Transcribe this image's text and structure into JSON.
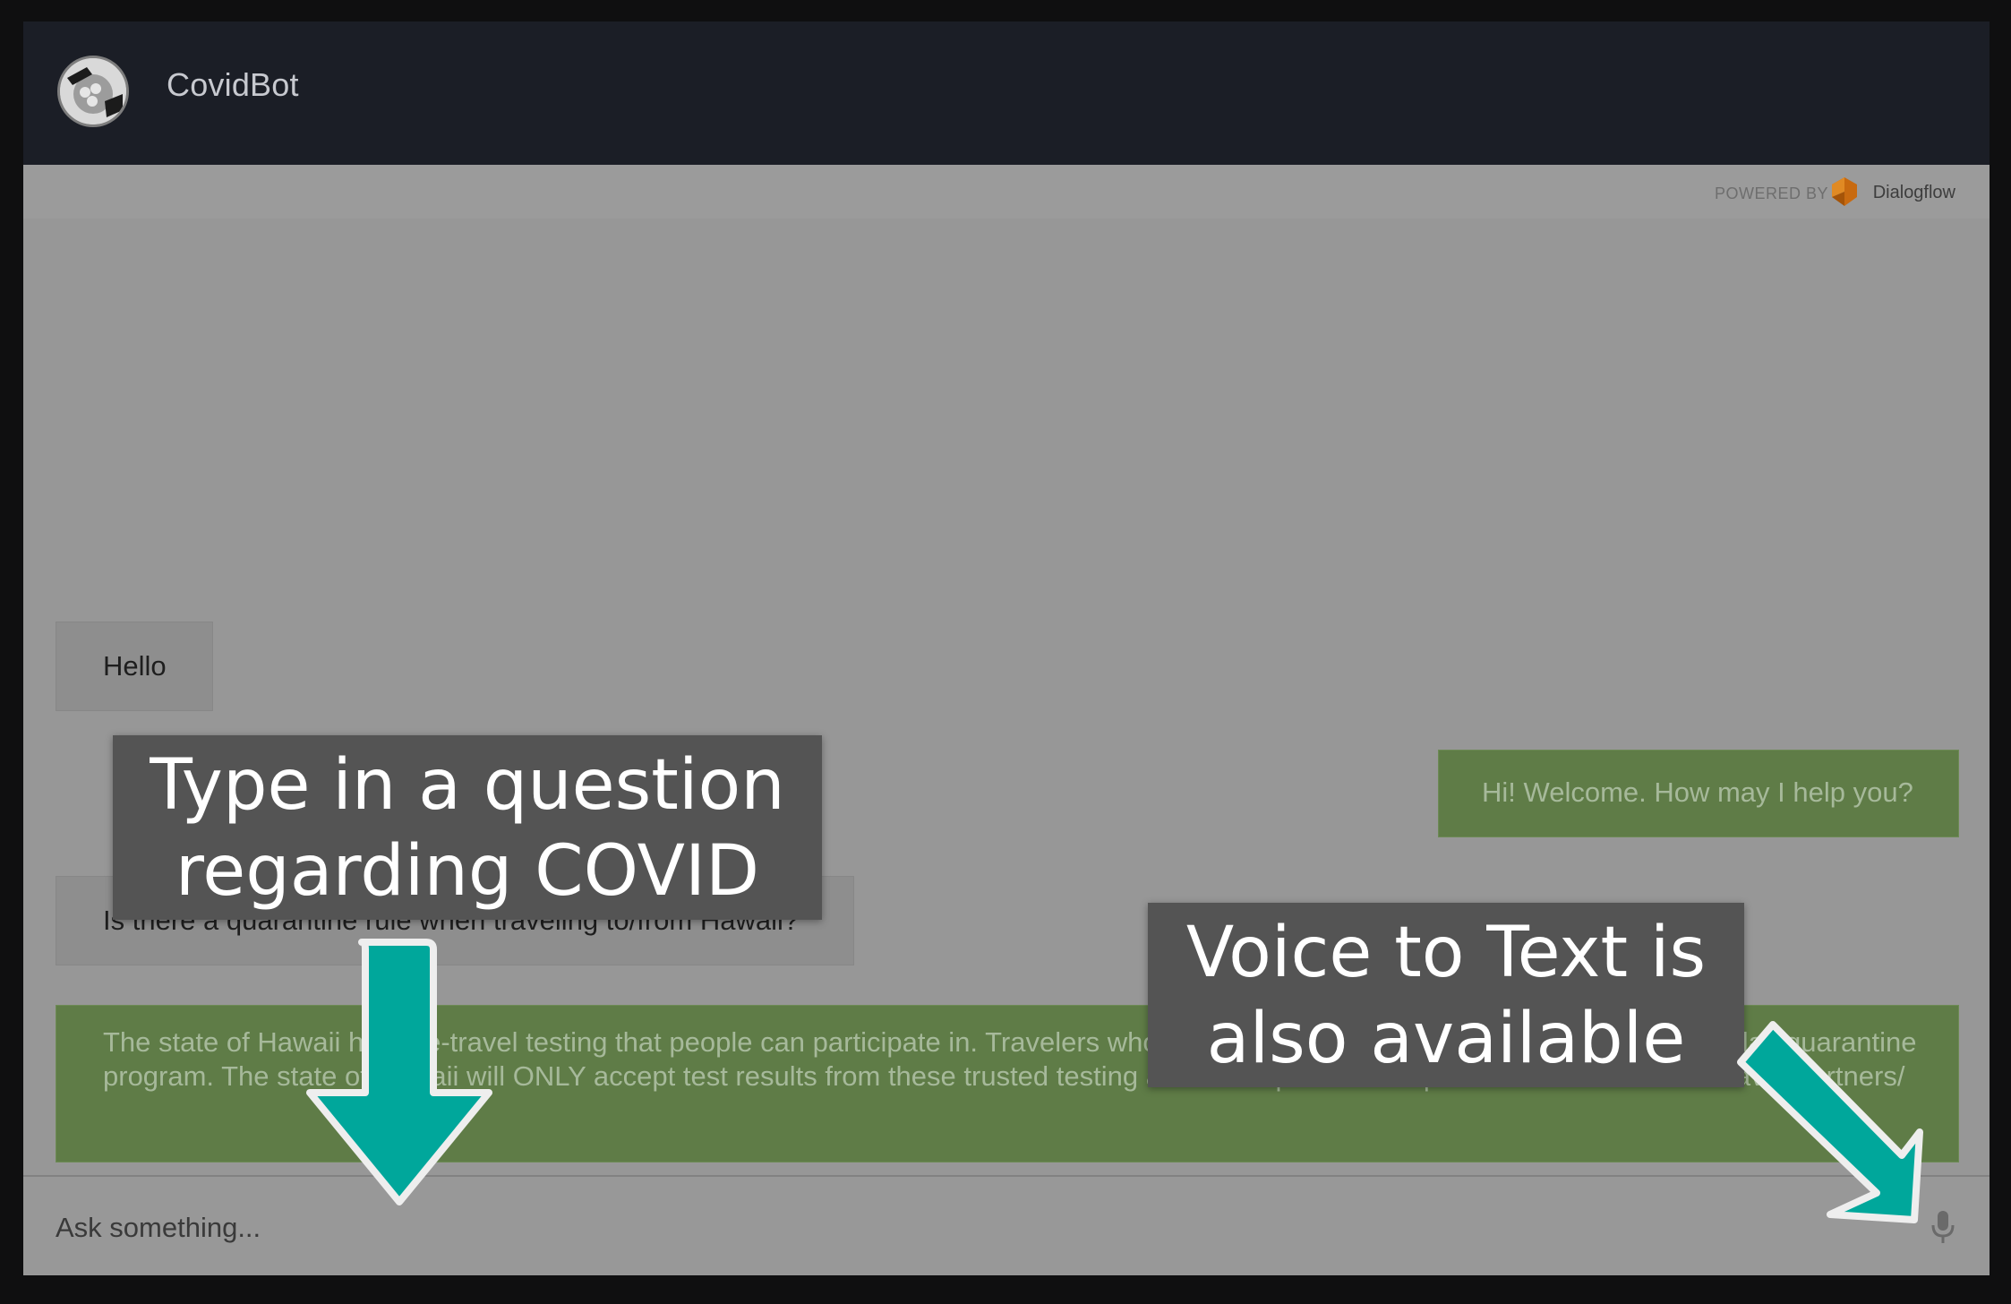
{
  "app": {
    "title": "CovidBot",
    "powered_by": "POWERED BY",
    "provider": "Dialogflow"
  },
  "messages": [
    {
      "role": "user",
      "text": "Hello"
    },
    {
      "role": "bot",
      "text": "Hi! Welcome. How may I help you?"
    },
    {
      "role": "user",
      "text": "Is there a quarantine rule when traveling to/from Hawaii?"
    },
    {
      "role": "bot",
      "text": "The state of Hawaii has pre-travel testing that people can participate in. Travelers who participate will not be subject to the state's 14-day quarantine program. The state of Hawaii will ONLY accept test results from these trusted testing and travel partners: https://hawaiicovid19.com/travel-partners/"
    }
  ],
  "input": {
    "placeholder": "Ask something...",
    "value": ""
  },
  "callouts": {
    "type_question": {
      "line1": "Type in a question",
      "line2": "regarding COVID"
    },
    "voice": {
      "line1": "Voice to Text is",
      "line2": "also available"
    }
  },
  "icons": {
    "avatar": "bot-logo-icon",
    "provider": "dialogflow-logo-icon",
    "mic": "microphone-icon",
    "arrow_down": "arrow-down-icon",
    "arrow_diag": "arrow-down-right-icon"
  },
  "colors": {
    "topbar": "#1b1e26",
    "bot_bubble": "#5f7c47",
    "user_bubble": "#8e8e8e",
    "callout_bg": "#545454",
    "arrow": "#00a79b"
  }
}
